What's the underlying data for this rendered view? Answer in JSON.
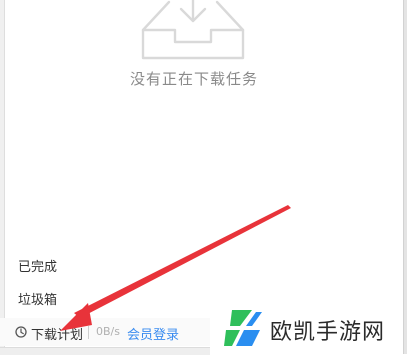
{
  "empty_state": {
    "icon": "inbox-download-icon",
    "message": "没有正在下载任务"
  },
  "sidebar": {
    "items": [
      {
        "label": "已完成"
      },
      {
        "label": "垃圾箱"
      }
    ]
  },
  "status_bar": {
    "plan_icon": "clock-icon",
    "plan_label": "下载计划",
    "speed": "0B/s",
    "member_login": "会员登录"
  },
  "annotation": {
    "arrow_color": "#e8333a"
  },
  "watermark": {
    "text": "欧凯手游网",
    "logo_colors": [
      "#2fbf5b",
      "#2a8ef0"
    ]
  }
}
